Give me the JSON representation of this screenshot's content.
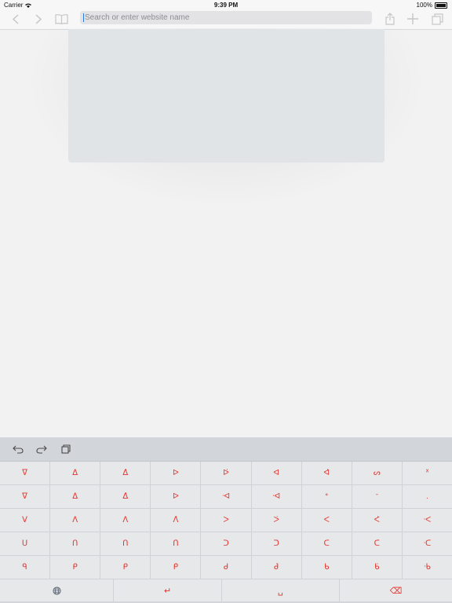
{
  "status": {
    "carrier": "Carrier",
    "time": "9:39 PM",
    "battery": "100%"
  },
  "toolbar": {
    "back_icon": "chevron-left-icon",
    "forward_icon": "chevron-right-icon",
    "bookmarks_icon": "book-icon",
    "address_placeholder": "Search or enter website name",
    "share_icon": "share-icon",
    "new_tab_icon": "plus-icon",
    "tabs_icon": "tabs-icon"
  },
  "keyboard": {
    "toolbar": {
      "undo_icon": "undo-icon",
      "redo_icon": "redo-icon",
      "paste_icon": "clipboard-icon"
    },
    "rows": [
      [
        "ᐁ",
        "ᐃ",
        "ᐃ̇",
        "ᐅ",
        "ᐅ̇",
        "ᐊ",
        "ᐊ̇",
        "ᔕ",
        "ᕽ"
      ],
      [
        "ᐁ",
        "ᐃ",
        "ᐃ̇",
        "ᐅ",
        "ᐧᐊ",
        "ᐧᐊ",
        "ᐤ",
        "ᐨ",
        "."
      ],
      [
        "ᐯ",
        "ᐱ",
        "ᐱ",
        "ᐱ̇",
        "ᐳ",
        "ᐳ̇",
        "ᐸ",
        "ᐸ̇",
        "ᐧᐸ"
      ],
      [
        "ᑌ",
        "ᑎ",
        "ᑎ",
        "ᑎ̇",
        "ᑐ",
        "ᑐ̇",
        "ᑕ",
        "ᑕ̇",
        "ᐧᑕ"
      ],
      [
        "ᑫ",
        "ᑭ",
        "ᑭ",
        "ᑭ̇",
        "ᑯ",
        "ᑯ̇",
        "ᑲ",
        "ᑲ̇",
        "ᐧᑲ"
      ]
    ],
    "bottom": {
      "globe_icon": "globe-icon",
      "return_label": "↵",
      "space_label": "␣",
      "delete_label": "⌫"
    },
    "key_color": "#e8322b"
  }
}
